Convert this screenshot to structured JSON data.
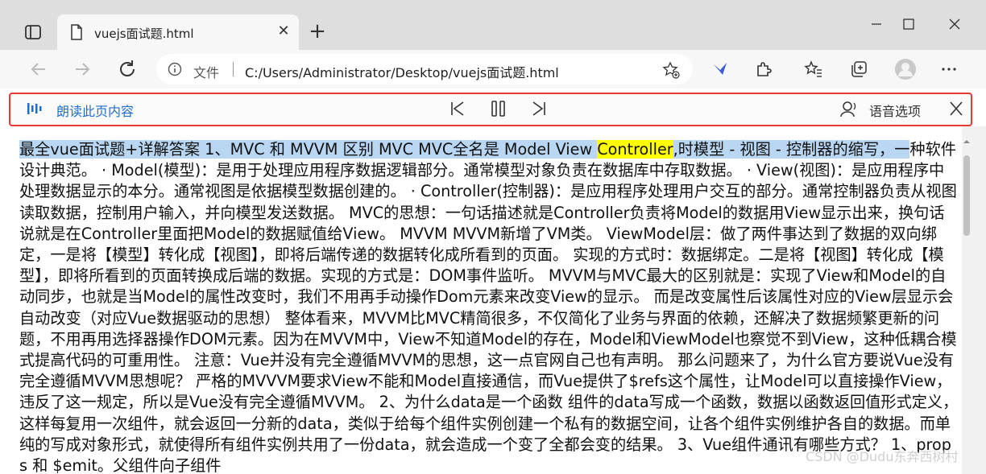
{
  "tab": {
    "title": "vuejs面试题.html",
    "favicon": "document-icon"
  },
  "window_controls": [
    "minimize-icon",
    "maximize-icon",
    "close-icon"
  ],
  "address_bar": {
    "info_icon": "info-icon",
    "scheme_label": "文件",
    "url": "C:/Users/Administrator/Desktop/vuejs面试题.html"
  },
  "toolbar_icons": [
    "add-favorite-icon",
    "extension-bird-icon",
    "extensions-icon",
    "favorites-icon",
    "collections-icon",
    "profile-icon",
    "more-icon"
  ],
  "read_aloud": {
    "label": "朗读此页内容",
    "voice_options": "语音选项",
    "accent": "#1f6fc9",
    "border_color": "#e53935"
  },
  "article": {
    "highlight_before": "最全vue面试题+详解答案 1、MVC 和 MVVM 区别 MVC MVC全名是 Model View ",
    "highlight_word": "Controller",
    "highlight_after": ",时模型 - 视图 - 控制器的缩写，一",
    "body": "种软件设计典范。 · Model(模型)：是用于处理应用程序数据逻辑部分。通常模型对象负责在数据库中存取数据。 · View(视图)：是应用程序中处理数据显示的本分。通常视图是依据模型数据创建的。 · Controller(控制器)：是应用程序处理用户交互的部分。通常控制器负责从视图读取数据，控制用户输入，并向模型发送数据。 MVC的思想：一句话描述就是Controller负责将Model的数据用View显示出来，换句话说就是在Controller里面把Model的数据赋值给View。 MVVM MVVM新增了VM类。 ViewModel层：做了两件事达到了数据的双向绑定，一是将【模型】转化成【视图】，即将后端传递的数据转化成所看到的页面。 实现的方式时：数据绑定。二是将【视图】转化成【模型】，即将所看到的页面转换成后端的数据。实现的方式是：DOM事件监听。 MVVM与MVC最大的区别就是：实现了View和Model的自动同步，也就是当Model的属性改变时，我们不用再手动操作Dom元素来改变View的显示。 而是改变属性后该属性对应的View层显示会自动改变（对应Vue数据驱动的思想） 整体看来，MVVM比MVC精简很多，不仅简化了业务与界面的依赖，还解决了数据频繁更新的问题，不用再用选择器操作DOM元素。因为在MVVM中，View不知道Model的存在，Model和ViewModel也察觉不到View，这种低耦合模式提高代码的可重用性。 注意：Vue并没有完全遵循MVVM的思想，这一点官网自己也有声明。 那么问题来了，为什么官方要说Vue没有完全遵循MVVM思想呢？ 严格的MVVVM要求View不能和Model直接通信，而Vue提供了$refs这个属性，让Model可以直接操作View，违反了这一规定，所以是Vue没有完全遵循MVVM。 2、为什么data是一个函数 组件的data写成一个函数，数据以函数返回值形式定义，这样每复用一次组件，就会返回一分新的data，类似于给每个组件实例创建一个私有的数据空间，让各个组件实例维护各自的数据。而单纯的写成对象形式，就使得所有组件实例共用了一份data，就会造成一个变了全都会变的结果。 3、Vue组件通讯有哪些方式？ 1、props 和 $emit。父组件向子组件"
  },
  "watermark": "CSDN @Dudu东奔西树村"
}
